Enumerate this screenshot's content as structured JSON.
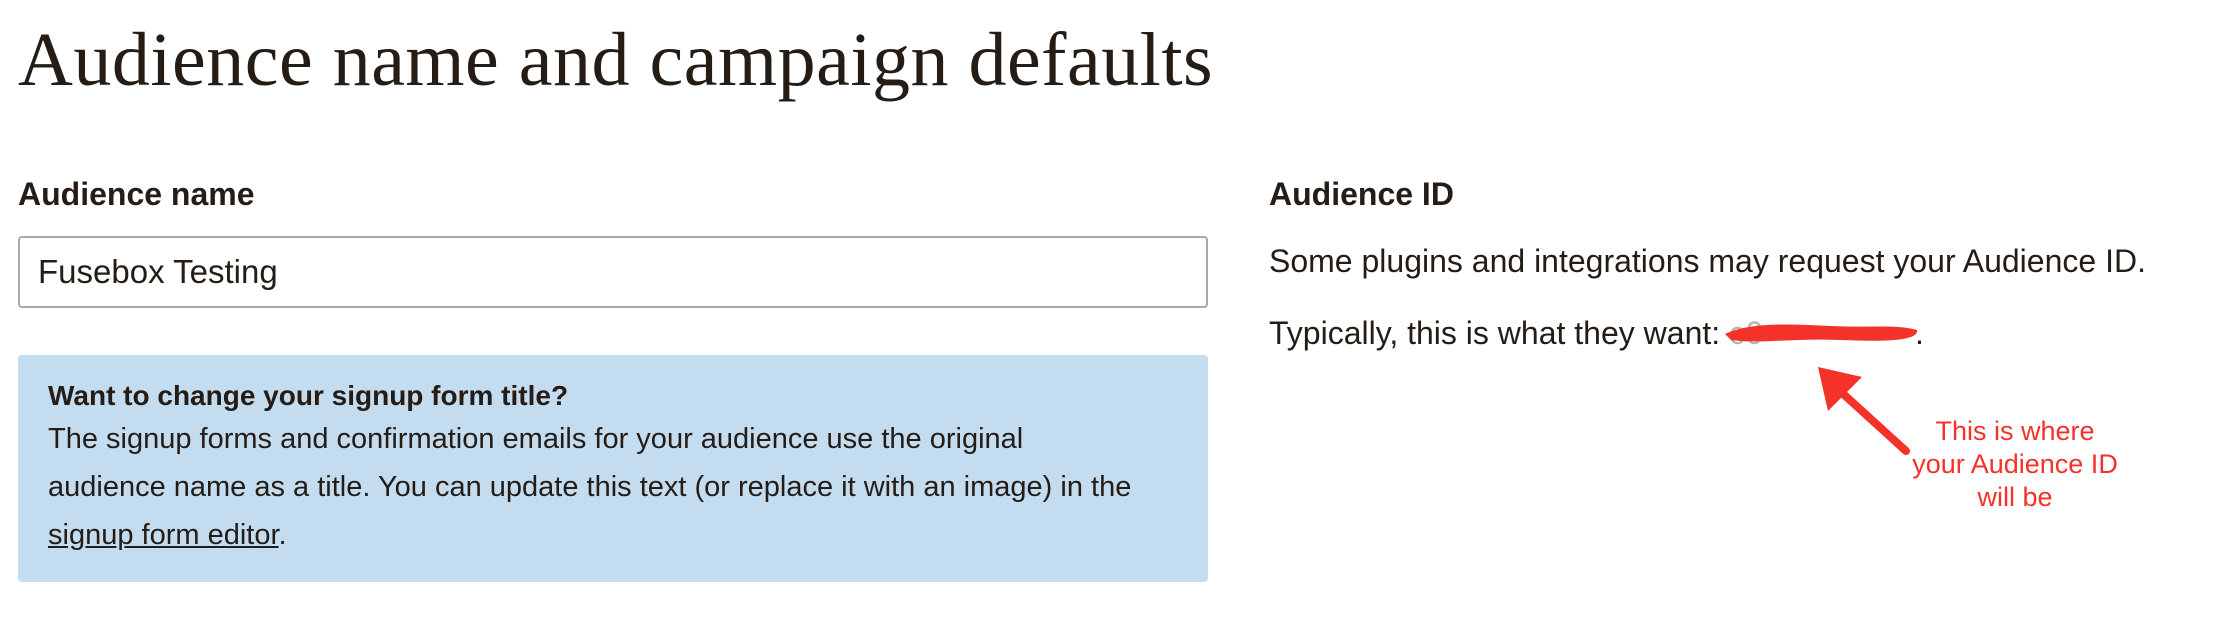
{
  "page": {
    "title": "Audience name and campaign defaults"
  },
  "audience_name": {
    "label": "Audience name",
    "value": "Fusebox Testing"
  },
  "info_box": {
    "title": "Want to change your signup form title?",
    "body_lines": [
      "The signup forms and confirmation emails for your audience use the original",
      "audience name as a title. You can update this text (or replace it with an image) in the"
    ],
    "link_text": "signup form editor",
    "link_suffix": ".",
    "background": "#c4dcf0"
  },
  "audience_id": {
    "label": "Audience ID",
    "description": "Some plugins and integrations may request your Audience ID.",
    "typically_prefix": "Typically, this is what they want:",
    "value_visible_fragment": "c6",
    "value_suffix": "."
  },
  "annotation": {
    "lines": [
      "This is where",
      "your Audience ID",
      "will be"
    ],
    "color": "#f4322a"
  },
  "colors": {
    "text": "#241c15",
    "input_border": "#a9a9a9",
    "redaction": "#f4322a"
  }
}
